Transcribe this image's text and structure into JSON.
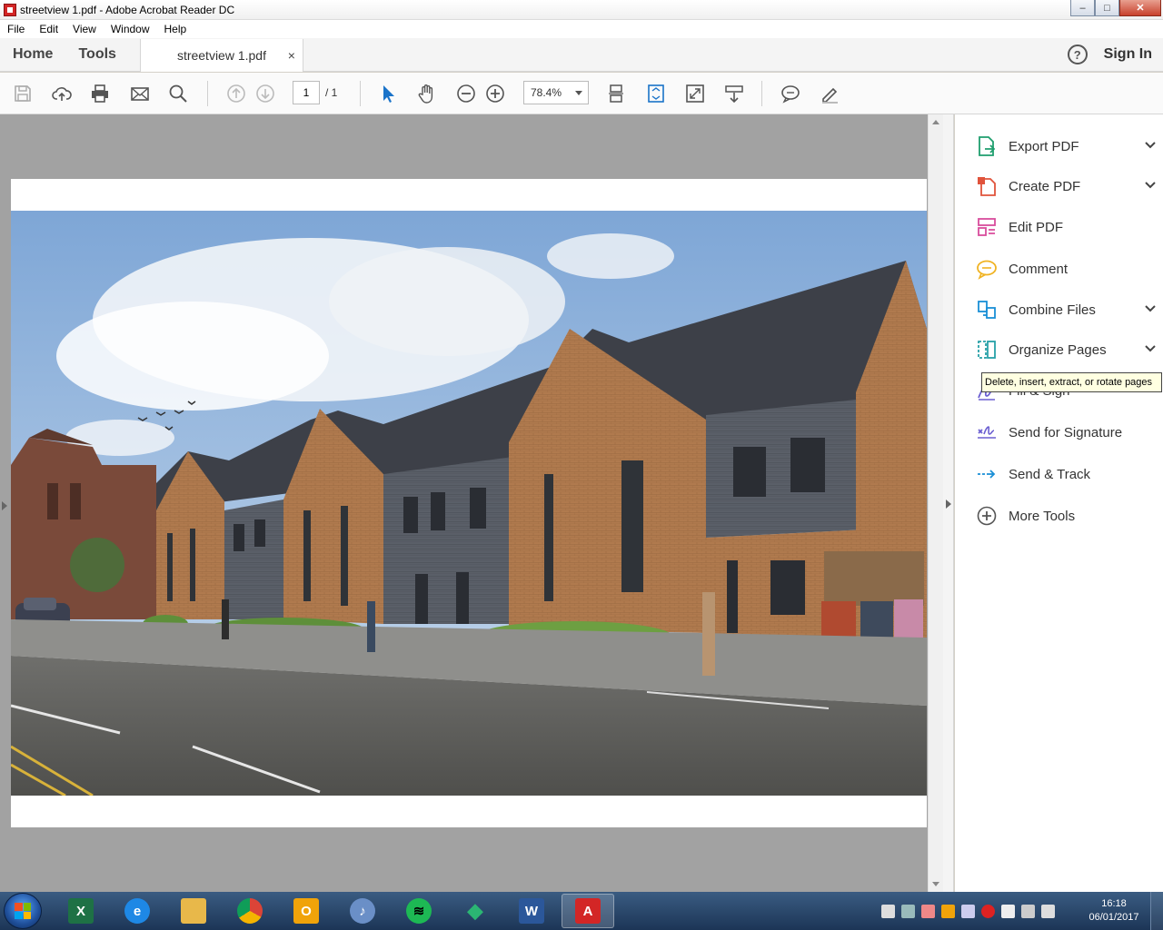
{
  "window": {
    "title": "streetview 1.pdf - Adobe Acrobat Reader DC",
    "minimize": "–",
    "maximize": "□",
    "close": "✕"
  },
  "menu": [
    "File",
    "Edit",
    "View",
    "Window",
    "Help"
  ],
  "tabs": {
    "home": "Home",
    "tools": "Tools",
    "document": "streetview 1.pdf",
    "close": "×"
  },
  "header": {
    "help": "?",
    "sign_in": "Sign In"
  },
  "toolbar": {
    "page_current": "1",
    "page_total": "/ 1",
    "zoom": "78.4%"
  },
  "tools_pane": {
    "items": [
      {
        "label": "Export PDF",
        "color": "#1f9e6e",
        "icon": "export-pdf-icon",
        "expand": true
      },
      {
        "label": "Create PDF",
        "color": "#e0533b",
        "icon": "create-pdf-icon",
        "expand": true
      },
      {
        "label": "Edit PDF",
        "color": "#d94c9c",
        "icon": "edit-pdf-icon",
        "expand": false
      },
      {
        "label": "Comment",
        "color": "#f0b323",
        "icon": "comment-icon",
        "expand": false
      },
      {
        "label": "Combine Files",
        "color": "#1a8fd6",
        "icon": "combine-files-icon",
        "expand": true
      },
      {
        "label": "Organize Pages",
        "color": "#27a0a8",
        "icon": "organize-pages-icon",
        "expand": true
      },
      {
        "label": "Fill & Sign",
        "color": "#6b5fd1",
        "icon": "fill-sign-icon",
        "expand": false
      },
      {
        "label": "Send for Signature",
        "color": "#6b5fd1",
        "icon": "send-signature-icon",
        "expand": false
      },
      {
        "label": "Send & Track",
        "color": "#1a8fd6",
        "icon": "send-track-icon",
        "expand": false
      },
      {
        "label": "More Tools",
        "color": "#555555",
        "icon": "more-tools-icon",
        "expand": false
      }
    ],
    "tooltip": "Delete, insert, extract, or rotate pages"
  },
  "taskbar": {
    "apps": [
      {
        "name": "excel",
        "glyph": "X",
        "color": "#1e7145"
      },
      {
        "name": "internet-explorer",
        "glyph": "e",
        "color": "#1e88e5"
      },
      {
        "name": "file-explorer",
        "glyph": "",
        "color": "#e8b84a"
      },
      {
        "name": "chrome",
        "glyph": "",
        "color": "#db4437"
      },
      {
        "name": "outlook",
        "glyph": "O",
        "color": "#f0a30a"
      },
      {
        "name": "itunes",
        "glyph": "♪",
        "color": "#6a8fc7"
      },
      {
        "name": "spotify",
        "glyph": "≋",
        "color": "#1db954"
      },
      {
        "name": "sketchup",
        "glyph": "◆",
        "color": "#2bb673"
      },
      {
        "name": "word",
        "glyph": "W",
        "color": "#2b579a"
      },
      {
        "name": "acrobat",
        "glyph": "A",
        "color": "#d32626"
      }
    ],
    "clock_time": "16:18",
    "clock_date": "06/01/2017"
  }
}
